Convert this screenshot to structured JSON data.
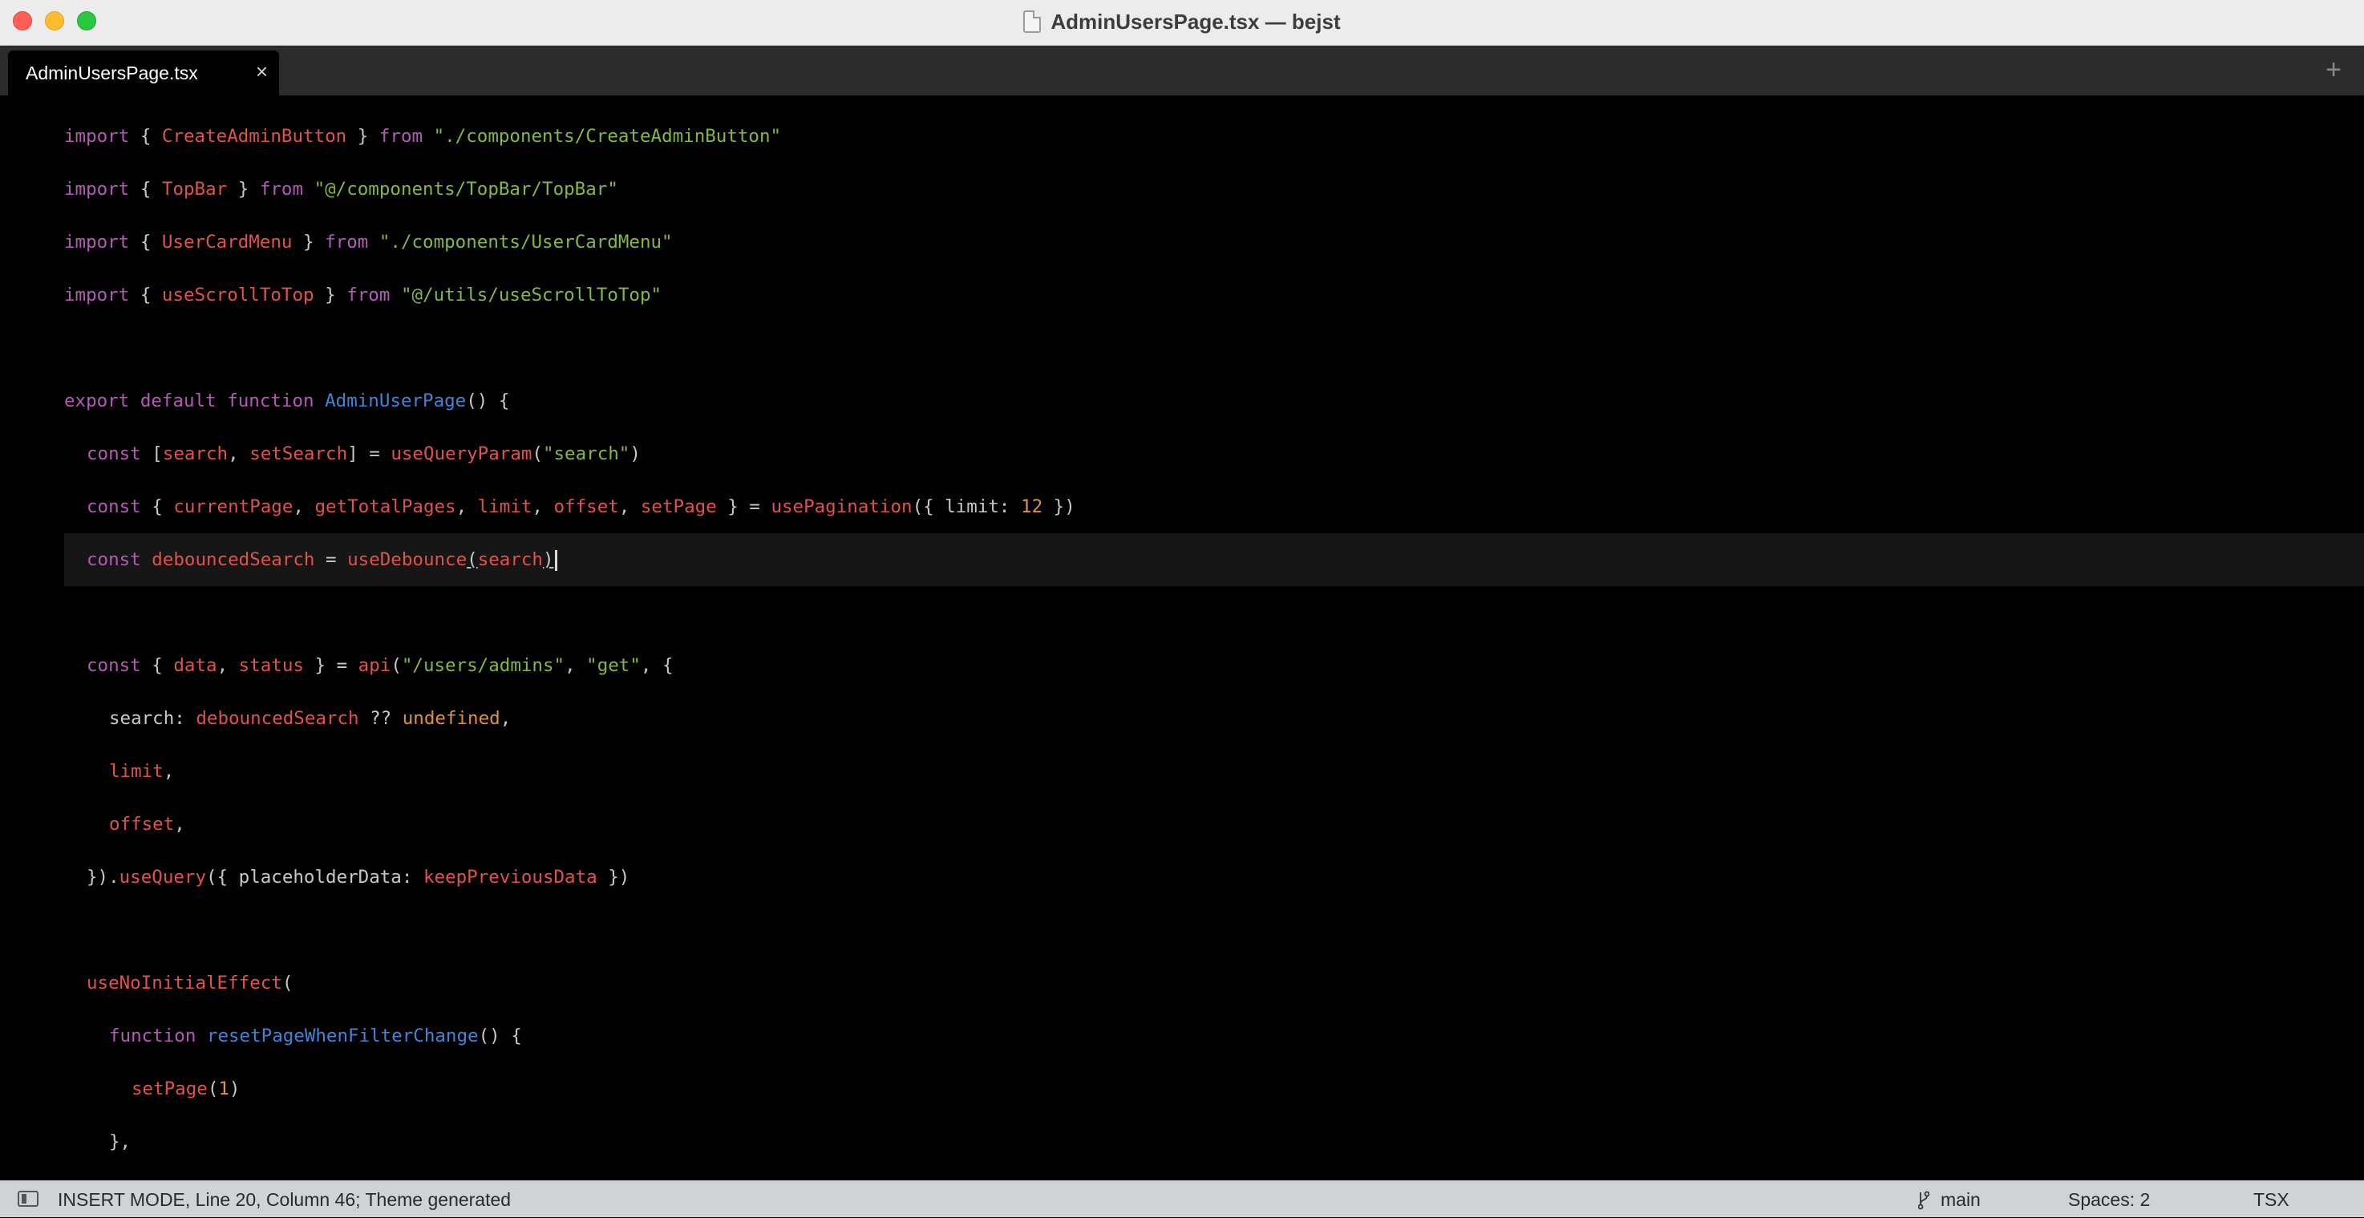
{
  "window": {
    "title": "AdminUsersPage.tsx — bejst"
  },
  "tabs": [
    {
      "label": "AdminUsersPage.tsx",
      "close_glyph": "×"
    }
  ],
  "tab_add_glyph": "+",
  "editor": {
    "lines": [
      {
        "row": 0,
        "indent": 0,
        "tokens": [
          {
            "t": "import",
            "c": "kw"
          },
          {
            "t": " { ",
            "c": "pl"
          },
          {
            "t": "CreateAdminButton",
            "c": "id"
          },
          {
            "t": " } ",
            "c": "pl"
          },
          {
            "t": "from",
            "c": "kw"
          },
          {
            "t": " ",
            "c": "pl"
          },
          {
            "t": "\"./components/CreateAdminButton\"",
            "c": "st"
          }
        ]
      },
      {
        "row": 1,
        "indent": 0,
        "tokens": [
          {
            "t": "import",
            "c": "kw"
          },
          {
            "t": " { ",
            "c": "pl"
          },
          {
            "t": "TopBar",
            "c": "id"
          },
          {
            "t": " } ",
            "c": "pl"
          },
          {
            "t": "from",
            "c": "kw"
          },
          {
            "t": " ",
            "c": "pl"
          },
          {
            "t": "\"@/components/TopBar/TopBar\"",
            "c": "st"
          }
        ]
      },
      {
        "row": 2,
        "indent": 0,
        "tokens": [
          {
            "t": "import",
            "c": "kw"
          },
          {
            "t": " { ",
            "c": "pl"
          },
          {
            "t": "UserCardMenu",
            "c": "id"
          },
          {
            "t": " } ",
            "c": "pl"
          },
          {
            "t": "from",
            "c": "kw"
          },
          {
            "t": " ",
            "c": "pl"
          },
          {
            "t": "\"./components/UserCardMenu\"",
            "c": "st"
          }
        ]
      },
      {
        "row": 3,
        "indent": 0,
        "tokens": [
          {
            "t": "import",
            "c": "kw"
          },
          {
            "t": " { ",
            "c": "pl"
          },
          {
            "t": "useScrollToTop",
            "c": "id"
          },
          {
            "t": " } ",
            "c": "pl"
          },
          {
            "t": "from",
            "c": "kw"
          },
          {
            "t": " ",
            "c": "pl"
          },
          {
            "t": "\"@/utils/useScrollToTop\"",
            "c": "st"
          }
        ]
      },
      {
        "row": 5,
        "indent": 0,
        "tokens": [
          {
            "t": "export",
            "c": "kw"
          },
          {
            "t": " ",
            "c": "pl"
          },
          {
            "t": "default",
            "c": "kw"
          },
          {
            "t": " ",
            "c": "pl"
          },
          {
            "t": "function",
            "c": "kw"
          },
          {
            "t": " ",
            "c": "pl"
          },
          {
            "t": "AdminUserPage",
            "c": "fn"
          },
          {
            "t": "() {",
            "c": "pl"
          }
        ]
      },
      {
        "row": 6,
        "indent": 1,
        "tokens": [
          {
            "t": "const",
            "c": "kw"
          },
          {
            "t": " [",
            "c": "pl"
          },
          {
            "t": "search",
            "c": "id"
          },
          {
            "t": ", ",
            "c": "pl"
          },
          {
            "t": "setSearch",
            "c": "id"
          },
          {
            "t": "] = ",
            "c": "pl"
          },
          {
            "t": "useQueryParam",
            "c": "id"
          },
          {
            "t": "(",
            "c": "pl"
          },
          {
            "t": "\"search\"",
            "c": "st"
          },
          {
            "t": ")",
            "c": "pl"
          }
        ]
      },
      {
        "row": 7,
        "indent": 1,
        "tokens": [
          {
            "t": "const",
            "c": "kw"
          },
          {
            "t": " { ",
            "c": "pl"
          },
          {
            "t": "currentPage",
            "c": "id"
          },
          {
            "t": ", ",
            "c": "pl"
          },
          {
            "t": "getTotalPages",
            "c": "id"
          },
          {
            "t": ", ",
            "c": "pl"
          },
          {
            "t": "limit",
            "c": "id"
          },
          {
            "t": ", ",
            "c": "pl"
          },
          {
            "t": "offset",
            "c": "id"
          },
          {
            "t": ", ",
            "c": "pl"
          },
          {
            "t": "setPage",
            "c": "id"
          },
          {
            "t": " } = ",
            "c": "pl"
          },
          {
            "t": "usePagination",
            "c": "id"
          },
          {
            "t": "({ limit: ",
            "c": "pl"
          },
          {
            "t": "12",
            "c": "nm"
          },
          {
            "t": " })",
            "c": "pl"
          }
        ]
      },
      {
        "row": 8,
        "indent": 1,
        "active": true,
        "tokens": [
          {
            "t": "const",
            "c": "kw"
          },
          {
            "t": " ",
            "c": "pl"
          },
          {
            "t": "debouncedSearch",
            "c": "id"
          },
          {
            "t": " = ",
            "c": "pl"
          },
          {
            "t": "useDebounce",
            "c": "id"
          },
          {
            "t": "(",
            "c": "pl",
            "u": true
          },
          {
            "t": "search",
            "c": "id"
          },
          {
            "t": ")",
            "c": "pl",
            "u": true
          }
        ]
      },
      {
        "row": 10,
        "indent": 1,
        "tokens": [
          {
            "t": "const",
            "c": "kw"
          },
          {
            "t": " { ",
            "c": "pl"
          },
          {
            "t": "data",
            "c": "id"
          },
          {
            "t": ", ",
            "c": "pl"
          },
          {
            "t": "status",
            "c": "id"
          },
          {
            "t": " } = ",
            "c": "pl"
          },
          {
            "t": "api",
            "c": "id"
          },
          {
            "t": "(",
            "c": "pl"
          },
          {
            "t": "\"/users/admins\"",
            "c": "st"
          },
          {
            "t": ", ",
            "c": "pl"
          },
          {
            "t": "\"get\"",
            "c": "st"
          },
          {
            "t": ", {",
            "c": "pl"
          }
        ]
      },
      {
        "row": 11,
        "indent": 2,
        "tokens": [
          {
            "t": "search: ",
            "c": "pl"
          },
          {
            "t": "debouncedSearch",
            "c": "id"
          },
          {
            "t": " ?? ",
            "c": "pl"
          },
          {
            "t": "undefined",
            "c": "nm"
          },
          {
            "t": ",",
            "c": "pl"
          }
        ]
      },
      {
        "row": 12,
        "indent": 2,
        "tokens": [
          {
            "t": "limit",
            "c": "id"
          },
          {
            "t": ",",
            "c": "pl"
          }
        ]
      },
      {
        "row": 13,
        "indent": 2,
        "tokens": [
          {
            "t": "offset",
            "c": "id"
          },
          {
            "t": ",",
            "c": "pl"
          }
        ]
      },
      {
        "row": 14,
        "indent": 1,
        "tokens": [
          {
            "t": "}).",
            "c": "pl"
          },
          {
            "t": "useQuery",
            "c": "id"
          },
          {
            "t": "({ placeholderData: ",
            "c": "pl"
          },
          {
            "t": "keepPreviousData",
            "c": "id"
          },
          {
            "t": " })",
            "c": "pl"
          }
        ]
      },
      {
        "row": 16,
        "indent": 1,
        "tokens": [
          {
            "t": "useNoInitialEffect",
            "c": "id"
          },
          {
            "t": "(",
            "c": "pl"
          }
        ]
      },
      {
        "row": 17,
        "indent": 2,
        "tokens": [
          {
            "t": "function",
            "c": "kw"
          },
          {
            "t": " ",
            "c": "pl"
          },
          {
            "t": "resetPageWhenFilterChange",
            "c": "fn"
          },
          {
            "t": "() {",
            "c": "pl"
          }
        ]
      },
      {
        "row": 18,
        "indent": 3,
        "tokens": [
          {
            "t": "setPage",
            "c": "id"
          },
          {
            "t": "(",
            "c": "pl"
          },
          {
            "t": "1",
            "c": "nm"
          },
          {
            "t": ")",
            "c": "pl"
          }
        ]
      },
      {
        "row": 19,
        "indent": 2,
        "tokens": [
          {
            "t": "},",
            "c": "pl"
          }
        ]
      }
    ]
  },
  "statusbar": {
    "mode_text": "INSERT MODE, Line 20, Column 46; Theme generated",
    "branch": "main",
    "spaces": "Spaces: 2",
    "language": "TSX"
  },
  "colors": {
    "keyword": "#b45ab4",
    "identifier": "#e0524a",
    "string": "#86b83c",
    "function": "#3e85d8",
    "plain": "#c8c8c8",
    "number": "#e0913c"
  }
}
